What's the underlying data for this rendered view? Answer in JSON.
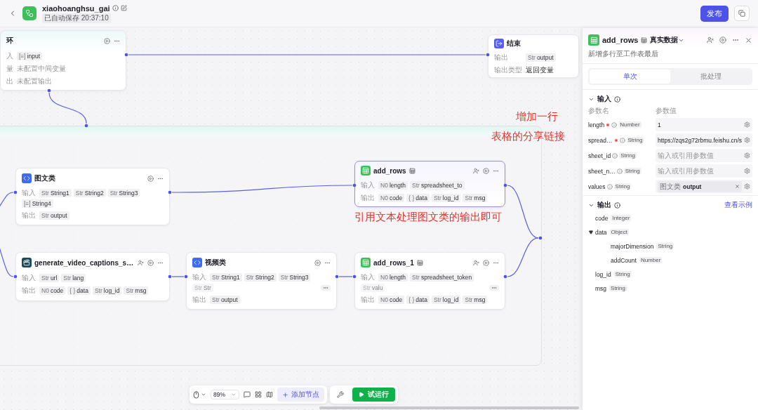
{
  "header": {
    "title": "xiaohoanghsu_gai",
    "saved": "已自动保存 20:37:10",
    "publish": "发布"
  },
  "nodes": [
    {
      "kind": "loop",
      "title": "环",
      "selected": false,
      "rows": [
        {
          "label": "入",
          "tags": [
            {
              "type": "[≡]",
              "name": "input"
            }
          ]
        },
        {
          "label": "量",
          "text": "未配置中间变量"
        },
        {
          "label": "出",
          "text": "未配置输出"
        }
      ]
    },
    {
      "kind": "code",
      "title": "图文类",
      "selected": false,
      "rows": [
        {
          "label": "输入",
          "tags": [
            {
              "type": "Str",
              "name": "String1"
            },
            {
              "type": "Str",
              "name": "String2"
            },
            {
              "type": "Str",
              "name": "String3"
            },
            {
              "type": "[≡]",
              "name": "String4"
            }
          ]
        },
        {
          "label": "输出",
          "tags": [
            {
              "type": "Str",
              "name": "output"
            }
          ]
        }
      ]
    },
    {
      "kind": "video",
      "title": "generate_video_captions_s…",
      "selected": false,
      "rows": [
        {
          "label": "输入",
          "tags": [
            {
              "type": "Str",
              "name": "url"
            },
            {
              "type": "Str",
              "name": "lang"
            }
          ]
        },
        {
          "label": "输出",
          "tags": [
            {
              "type": "N0",
              "name": "code"
            },
            {
              "type": "{ }",
              "name": "data"
            },
            {
              "type": "Str",
              "name": "log_id"
            },
            {
              "type": "Str",
              "name": "msg"
            }
          ]
        }
      ]
    },
    {
      "kind": "code",
      "title": "视频类",
      "selected": false,
      "rows": [
        {
          "label": "输入",
          "more": true,
          "tags": [
            {
              "type": "Str",
              "name": "String1"
            },
            {
              "type": "Str",
              "name": "String2"
            },
            {
              "type": "Str",
              "name": "String3"
            },
            {
              "type": "Str",
              "name": "Str",
              "faded": true
            }
          ]
        },
        {
          "label": "输出",
          "tags": [
            {
              "type": "Str",
              "name": "output"
            }
          ]
        }
      ]
    },
    {
      "kind": "sheet",
      "title": "add_rows",
      "selected": true,
      "rows": [
        {
          "label": "输入",
          "tags": [
            {
              "type": "N0",
              "name": "length"
            },
            {
              "type": "Str",
              "name": "spreadsheet_to"
            }
          ]
        },
        {
          "label": "输出",
          "tags": [
            {
              "type": "N0",
              "name": "code"
            },
            {
              "type": "{ }",
              "name": "data"
            },
            {
              "type": "Str",
              "name": "log_id"
            },
            {
              "type": "Str",
              "name": "msg"
            }
          ]
        }
      ]
    },
    {
      "kind": "sheet",
      "title": "add_rows_1",
      "selected": false,
      "rows": [
        {
          "label": "输入",
          "more": true,
          "tags": [
            {
              "type": "N0",
              "name": "length"
            },
            {
              "type": "Str",
              "name": "spreadsheet_token"
            },
            {
              "type": "Str",
              "name": "valu",
              "faded": true
            }
          ]
        },
        {
          "label": "输出",
          "tags": [
            {
              "type": "N0",
              "name": "code"
            },
            {
              "type": "{ }",
              "name": "data"
            },
            {
              "type": "Str",
              "name": "log_id"
            },
            {
              "type": "Str",
              "name": "msg"
            }
          ]
        }
      ]
    },
    {
      "kind": "end",
      "title": "结束",
      "selected": false,
      "rows": [
        {
          "label": "输出",
          "tags": [
            {
              "type": "Str",
              "name": "output"
            }
          ]
        },
        {
          "label": "输出类型",
          "text": "返回变量"
        }
      ]
    }
  ],
  "annotations": [
    {
      "text": "增加一行"
    },
    {
      "text": "表格的分享链接"
    },
    {
      "text": "引用文本处理图文类的输出即可"
    }
  ],
  "panel": {
    "title": "add_rows",
    "data_source": "真实数据",
    "description": "新增多行至工作表最后",
    "tabs": [
      {
        "label": "单次",
        "selected": true
      },
      {
        "label": "批处理",
        "selected": false
      }
    ],
    "input_title": "输入",
    "col_name": "参数名",
    "col_value": "参数值",
    "params": [
      {
        "name": "length",
        "required": true,
        "type": "Number",
        "value": "1"
      },
      {
        "name": "spread…",
        "required": true,
        "type": "String",
        "value": "https://zqs2g72rbmu.feishu.cn/s"
      },
      {
        "name": "sheet_id",
        "required": false,
        "type": "String",
        "placeholder": "输入或引用参数值"
      },
      {
        "name": "sheet_n…",
        "required": false,
        "type": "String",
        "placeholder": "输入或引用参数值"
      },
      {
        "name": "values",
        "required": false,
        "type": "String",
        "ref": {
          "node": "图文类",
          "field": "output"
        }
      }
    ],
    "output_title": "输出",
    "example_link": "查看示例",
    "outputs": [
      {
        "name": "code",
        "type": "Integer"
      },
      {
        "name": "data",
        "type": "Object",
        "expanded": true,
        "children": [
          {
            "name": "majorDimension",
            "type": "String"
          },
          {
            "name": "addCount",
            "type": "Number"
          }
        ]
      },
      {
        "name": "log_id",
        "type": "String"
      },
      {
        "name": "msg",
        "type": "String"
      }
    ]
  },
  "toolbar": {
    "zoom": "89%",
    "add_node": "添加节点",
    "run": "试运行"
  }
}
